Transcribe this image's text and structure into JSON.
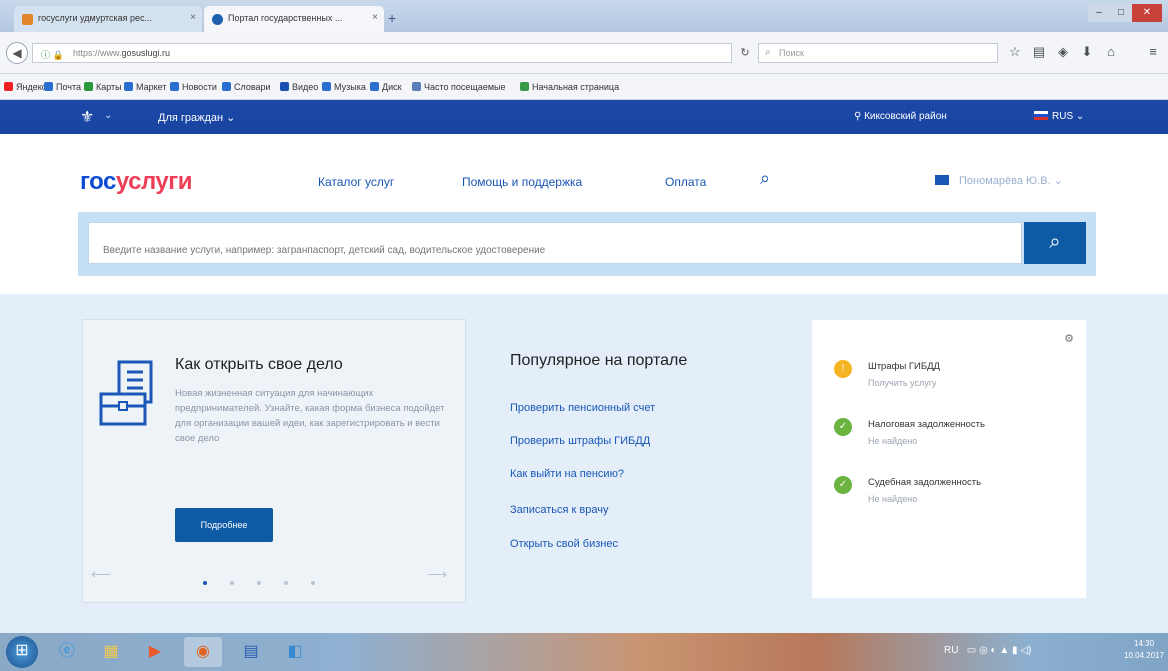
{
  "browser": {
    "tabs": [
      {
        "label": "госуслуги удмуртская рес...",
        "close": "×"
      },
      {
        "label": "Портал государственных ...",
        "close": "×"
      }
    ],
    "new_tab": "+",
    "url_prefix": "https://www.",
    "url_domain": "gosuslugi.ru",
    "search_placeholder": "Поиск",
    "bookmarks": [
      "Яндекс",
      "Почта",
      "Карты",
      "Маркет",
      "Новости",
      "Словари",
      "Видео",
      "Музыка",
      "Диск",
      "Часто посещаемые",
      "Начальная страница"
    ],
    "window_controls": {
      "minimize": "–",
      "maximize": "□",
      "close": "✕"
    }
  },
  "site_top": {
    "menu": "Для граждан",
    "region": "Кикcовский район",
    "language": "RUS"
  },
  "header": {
    "logo_part1": "гос",
    "logo_part2": "услуги",
    "nav": [
      "Каталог услуг",
      "Помощь и поддержка",
      "Оплата"
    ],
    "user": "Пономарёва Ю.В."
  },
  "search": {
    "placeholder": "Введите название услуги, например: загранпаспорт, детский сад, водительское удостоверение"
  },
  "promo": {
    "title": "Как открыть свое дело",
    "text": "Новая жизненная ситуация для начинающих предпринимателей. Узнайте, какая форма бизнеса подойдет для организации вашей идеи, как зарегистрировать и вести свое дело",
    "button": "Подробнее",
    "arrow_left": "⟵",
    "arrow_right": "⟶"
  },
  "popular": {
    "title": "Популярное на портале",
    "links": [
      "Проверить пенсионный счет",
      "Проверить штрафы ГИБДД",
      "Как выйти на пенсию?",
      "Записаться к врачу",
      "Открыть свой бизнес"
    ]
  },
  "status_card": {
    "items": [
      {
        "title": "Штрафы ГИБДД",
        "subtitle": "Получить услугу",
        "color": "#f5b422",
        "icon": "!"
      },
      {
        "title": "Налоговая задолженность",
        "subtitle": "Не найдено",
        "color": "#6cb33f",
        "icon": "✓"
      },
      {
        "title": "Судебная задолженность",
        "subtitle": "Не найдено",
        "color": "#6cb33f",
        "icon": "✓"
      }
    ]
  },
  "taskbar": {
    "tray_lang": "RU",
    "time": "14:30",
    "date": "10.04.2017"
  },
  "colors": {
    "brand_blue": "#0d4cd3",
    "brand_red": "#ee3f58",
    "button_blue": "#0f5aa5",
    "warning": "#f5b422",
    "success": "#6cb33f"
  }
}
